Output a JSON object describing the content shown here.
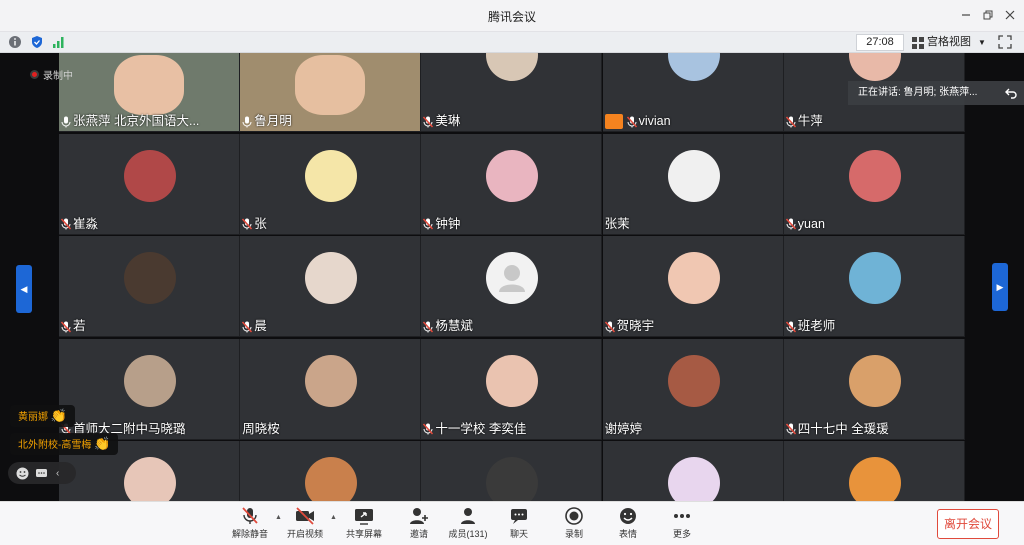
{
  "window": {
    "title": "腾讯会议"
  },
  "infobar": {
    "timer": "27:08",
    "view_label": "宫格视图"
  },
  "recording": {
    "label": "录制中"
  },
  "speaking": {
    "text": "正在讲话: 鲁月明; 张燕萍..."
  },
  "tiles": [
    {
      "name": "张燕萍  北京外国语大...",
      "mic": "on",
      "kind": "video"
    },
    {
      "name": "鲁月明",
      "mic": "on",
      "kind": "video2"
    },
    {
      "name": "美琳",
      "mic": "muted",
      "kind": "avatar"
    },
    {
      "name": "vivian",
      "mic": "muted",
      "kind": "avatar"
    },
    {
      "name": "牛萍",
      "mic": "muted",
      "kind": "avatar"
    },
    {
      "name": "崔淼",
      "mic": "muted",
      "kind": "avatar"
    },
    {
      "name": "张",
      "mic": "muted",
      "kind": "avatar"
    },
    {
      "name": "钟钟",
      "mic": "muted",
      "kind": "avatar"
    },
    {
      "name": "张茉",
      "mic": "none",
      "kind": "avatar"
    },
    {
      "name": "yuan",
      "mic": "muted",
      "kind": "avatar"
    },
    {
      "name": "若",
      "mic": "muted",
      "kind": "avatar"
    },
    {
      "name": "晨",
      "mic": "muted",
      "kind": "avatar"
    },
    {
      "name": "杨慧斌",
      "mic": "muted",
      "kind": "avatar"
    },
    {
      "name": "贺晓宇",
      "mic": "muted",
      "kind": "avatar"
    },
    {
      "name": "班老师",
      "mic": "muted",
      "kind": "avatar"
    },
    {
      "name": "首师大二附中马晓璐",
      "mic": "muted",
      "kind": "avatar"
    },
    {
      "name": "周晓桉",
      "mic": "none",
      "kind": "avatar"
    },
    {
      "name": "十一学校 李奕佳",
      "mic": "muted",
      "kind": "avatar"
    },
    {
      "name": "谢婷婷",
      "mic": "none",
      "kind": "avatar"
    },
    {
      "name": "四十七中 全瑗瑗",
      "mic": "muted",
      "kind": "avatar"
    },
    {
      "name": "",
      "mic": "none",
      "kind": "avatar"
    },
    {
      "name": "",
      "mic": "none",
      "kind": "avatar"
    },
    {
      "name": "",
      "mic": "none",
      "kind": "avatar"
    },
    {
      "name": "",
      "mic": "none",
      "kind": "avatar"
    },
    {
      "name": "",
      "mic": "none",
      "kind": "avatar"
    }
  ],
  "hands": [
    {
      "name": "黄丽娜"
    },
    {
      "name": "北外附校-高雪梅"
    }
  ],
  "toolbar": {
    "unmute": "解除静音",
    "video": "开启视频",
    "share": "共享屏幕",
    "invite": "邀请",
    "members": "成员(131)",
    "chat": "聊天",
    "record": "录制",
    "reaction": "表情",
    "more": "更多",
    "leave": "离开会议"
  },
  "colors": {
    "accent": "#1d67d6",
    "danger": "#e04a3c",
    "hand": "#f2a100",
    "record": "#e02020"
  }
}
